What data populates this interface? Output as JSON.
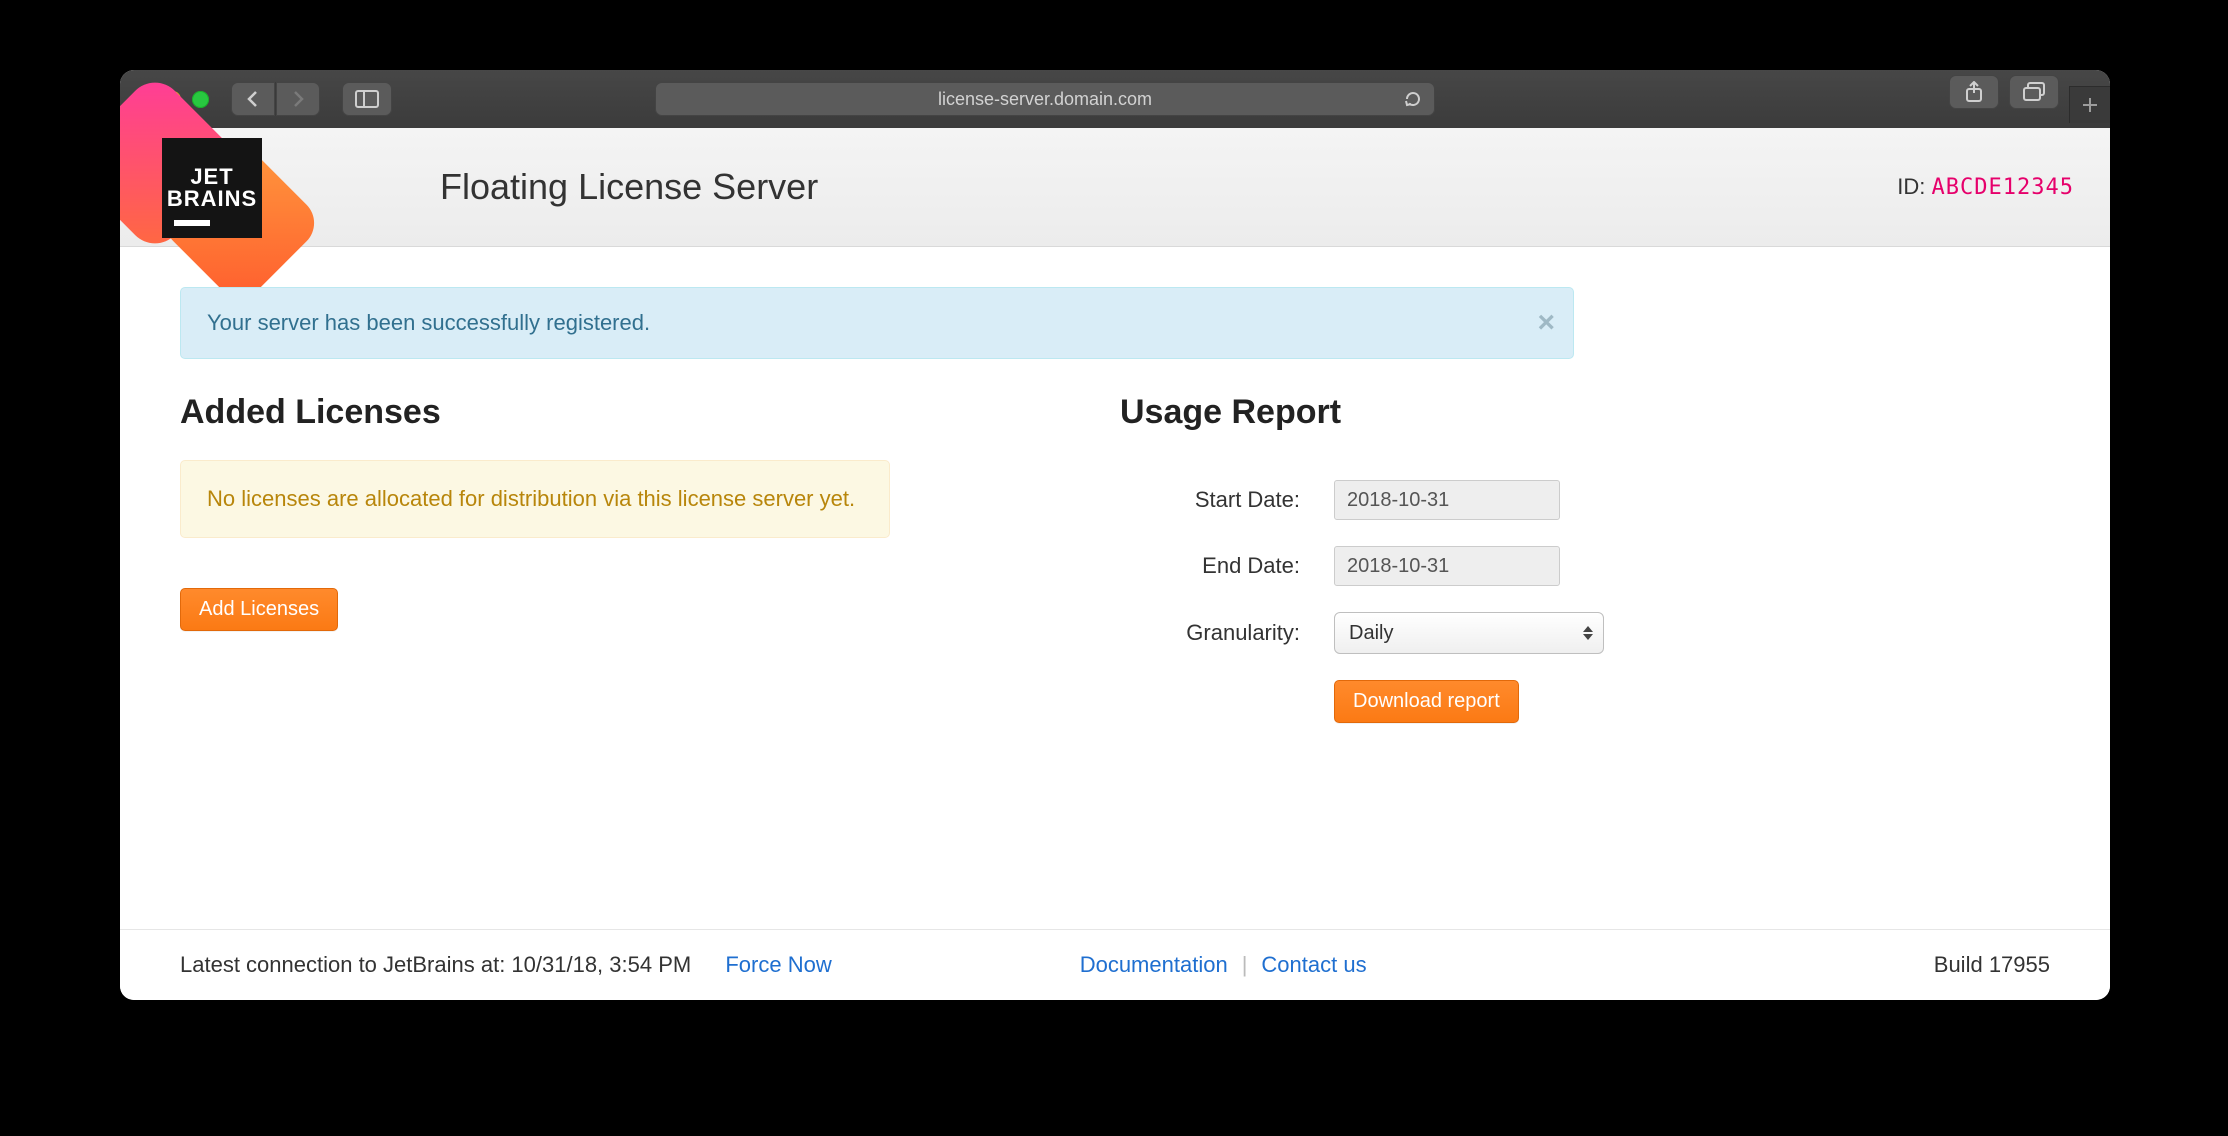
{
  "browser": {
    "address": "license-server.domain.com"
  },
  "header": {
    "logo_line1": "JET",
    "logo_line2": "BRAINS",
    "title": "Floating License Server",
    "id_label": "ID:",
    "id_value": "ABCDE12345"
  },
  "alert_success": "Your server has been successfully registered.",
  "licenses": {
    "heading": "Added Licenses",
    "warning": "No licenses are allocated for distribution via this license server yet.",
    "add_button": "Add Licenses"
  },
  "usage": {
    "heading": "Usage Report",
    "start_label": "Start Date:",
    "start_value": "2018-10-31",
    "end_label": "End Date:",
    "end_value": "2018-10-31",
    "granularity_label": "Granularity:",
    "granularity_value": "Daily",
    "download_button": "Download report"
  },
  "footer": {
    "connection_prefix": "Latest connection to JetBrains at: ",
    "connection_time": "10/31/18, 3:54 PM",
    "force_now": "Force Now",
    "documentation": "Documentation",
    "contact": "Contact us",
    "build_label": "Build ",
    "build_value": "17955"
  }
}
